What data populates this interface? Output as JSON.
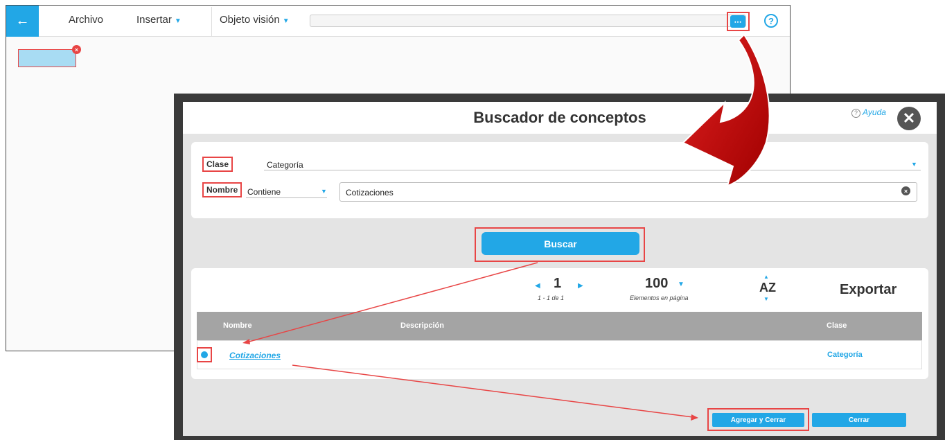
{
  "app": {
    "back_icon": "arrow-left-icon",
    "menu": [
      {
        "label": "Archivo",
        "has_caret": false
      },
      {
        "label": "Insertar",
        "has_caret": true
      },
      {
        "label": "Objeto visión",
        "has_caret": true
      }
    ],
    "more_label": "⋯",
    "help_label": "?",
    "canvas_close": "×"
  },
  "modal": {
    "title": "Buscador de conceptos",
    "help_link": "Ayuda",
    "close": "✕",
    "filters": {
      "class_label": "Clase",
      "class_value": "Categoría",
      "name_label": "Nombre",
      "operator_value": "Contiene",
      "name_value": "Cotizaciones"
    },
    "search_button": "Buscar",
    "pager": {
      "page": "1",
      "range": "1 - 1 de 1",
      "per_page": "100",
      "per_page_label": "Elementos en página",
      "sort_label": "AZ",
      "export_label": "Exportar"
    },
    "table": {
      "headers": [
        "Nombre",
        "Descripción",
        "Clase"
      ],
      "rows": [
        {
          "name": "Cotizaciones",
          "description": "",
          "class": "Categoría",
          "selected": true
        }
      ]
    },
    "add_close_button": "Agregar y Cerrar",
    "close_button": "Cerrar"
  },
  "colors": {
    "accent": "#22a7e6",
    "highlight": "#e84545",
    "callout_arrow": "#c00000",
    "table_header": "#a4a4a4"
  }
}
